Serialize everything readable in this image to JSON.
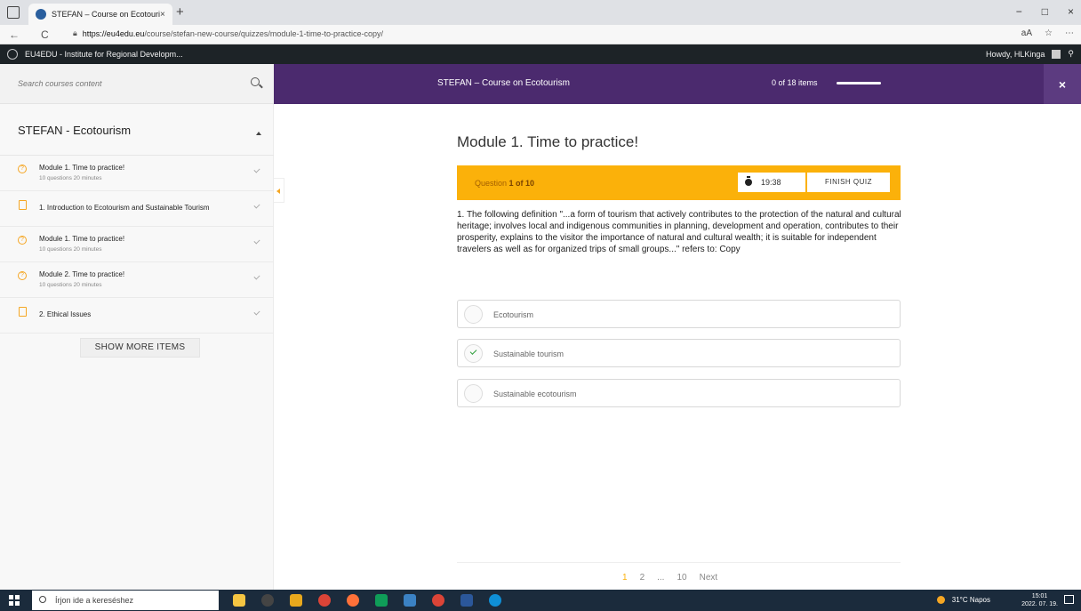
{
  "browser": {
    "tab_title": "STEFAN – Course on Ecotourism",
    "tab_close": "×",
    "new_tab": "+",
    "back": "←",
    "reload": "C",
    "url_host": "https://eu4edu.eu",
    "url_path": "/course/stefan-new-course/quizzes/module-1-time-to-practice-copy/",
    "window_controls": [
      "−",
      "□",
      "×"
    ],
    "toolbar_icons": [
      "aA",
      "☆",
      "⋯"
    ]
  },
  "wpbar": {
    "site_name": "EU4EDU - Institute for Regional Developm...",
    "howdy": "Howdy, HLKinga"
  },
  "header": {
    "search_placeholder": "Search courses content",
    "course_title": "STEFAN – Course on Ecotourism",
    "progress_text": "0 of 18 items",
    "progress_fraction": 0,
    "close_label": "×"
  },
  "sidebar": {
    "section_title": "STEFAN - Ecotourism",
    "items": [
      {
        "type": "quiz",
        "name": "Module 1. Time to practice!",
        "meta": "10 questions   20 minutes"
      },
      {
        "type": "lesson",
        "name": "1. Introduction to Ecotourism and Sustainable Tourism",
        "meta": ""
      },
      {
        "type": "quiz",
        "name": "Module 1. Time to practice!",
        "meta": "10 questions   20 minutes"
      },
      {
        "type": "quiz",
        "name": "Module 2. Time to practice!",
        "meta": "10 questions   20 minutes"
      },
      {
        "type": "lesson",
        "name": "2. Ethical Issues",
        "meta": ""
      }
    ],
    "show_more_label": "SHOW MORE ITEMS"
  },
  "quiz": {
    "title": "Module 1. Time to practice!",
    "question_prefix": "Question ",
    "question_current": "1 of 10",
    "timer": "19:38",
    "finish_label": "FINISH QUIZ",
    "question_text": "1. The following definition \"...a form of tourism that actively contributes to the protection of the natural and cultural heritage; involves local and indigenous communities in planning, development and operation, contributes to their prosperity, explains to the visitor the importance of natural and cultural wealth; it is suitable for independent travelers as well as for organized trips of small groups...\" refers to: Copy",
    "options": [
      {
        "label": "Ecotourism",
        "checked": false
      },
      {
        "label": "Sustainable tourism",
        "checked": true
      },
      {
        "label": "Sustainable ecotourism",
        "checked": false
      }
    ],
    "pager": [
      "1",
      "2",
      "...",
      "10",
      "Next"
    ]
  },
  "taskbar": {
    "search_placeholder": "Írjon ide a kereséshez",
    "weather": "31°C  Napos",
    "time": "15:01",
    "date": "2022. 07. 19."
  }
}
